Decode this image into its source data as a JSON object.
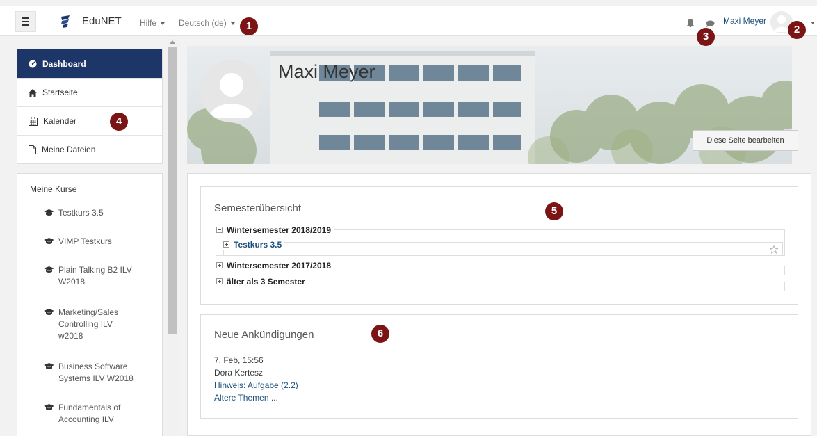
{
  "navbar": {
    "brand": "EduNET",
    "help_label": "Hilfe",
    "language_label": "Deutsch (de)",
    "username": "Maxi Meyer"
  },
  "markers": [
    "1",
    "2",
    "3",
    "4",
    "5",
    "6"
  ],
  "sidebar": {
    "items": [
      {
        "label": "Dashboard",
        "icon": "dashboard-icon",
        "active": true
      },
      {
        "label": "Startseite",
        "icon": "home-icon"
      },
      {
        "label": "Kalender",
        "icon": "calendar-icon"
      },
      {
        "label": "Meine Dateien",
        "icon": "file-icon"
      }
    ],
    "courses_title": "Meine Kurse",
    "courses": [
      [
        "Testkurs 3.5"
      ],
      [
        "VIMP Testkurs"
      ],
      [
        "Plain Talking B2 ILV",
        "W2018"
      ],
      [
        "Marketing/Sales",
        "Controlling ILV",
        "w2018"
      ],
      [
        "Business Software",
        "Systems ILV W2018"
      ],
      [
        "Fundamentals of",
        "Accounting ILV"
      ]
    ]
  },
  "header": {
    "name": "Maxi Meyer",
    "edit_button": "Diese Seite bearbeiten"
  },
  "semester_overview": {
    "title": "Semesterübersicht",
    "semesters": [
      {
        "label": "Wintersemester 2018/2019",
        "expanded": true,
        "courses": [
          "Testkurs 3.5"
        ]
      },
      {
        "label": "Wintersemester 2017/2018",
        "expanded": false
      },
      {
        "label": "älter als 3 Semester",
        "expanded": false
      }
    ]
  },
  "announcements": {
    "title": "Neue Ankündigungen",
    "date": "7. Feb, 15:56",
    "author": "Dora Kertesz",
    "post_link": "Hinweis: Aufgabe (2.2)",
    "older_link": "Ältere Themen ..."
  },
  "colors": {
    "accent": "#1d3668",
    "marker": "#7b1515",
    "link": "#1a4f7c"
  }
}
